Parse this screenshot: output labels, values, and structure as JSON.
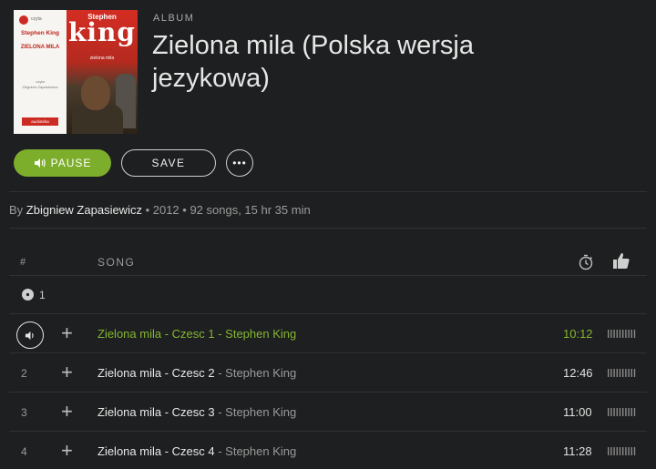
{
  "album": {
    "label": "ALBUM",
    "title": "Zielona mila (Polska wersja jezykowa)",
    "cover": {
      "author": "Stephen King",
      "big_title": "king",
      "big_author": "Stephen",
      "title": "ZIELONA MILA",
      "subtitle": "czyta",
      "reader": "Zbigniew Zapasiewicz",
      "book_title": "zielona mila",
      "badge": "audioteka",
      "publisher": "czyta"
    }
  },
  "buttons": {
    "pause": "PAUSE",
    "save": "SAVE",
    "more": "•••"
  },
  "meta": {
    "by": "By",
    "artist": "Zbigniew Zapasiewicz",
    "details": " • 2012 • 92 songs, 15 hr 35 min"
  },
  "table": {
    "col_num": "#",
    "col_song": "SONG",
    "disc_label": "1"
  },
  "tracks": [
    {
      "num": "",
      "title": "Zielona mila - Czesc 1",
      "sep": " - ",
      "artist": "Stephen King",
      "duration": "10:12",
      "active": true
    },
    {
      "num": "2",
      "title": "Zielona mila - Czesc 2",
      "sep": " - ",
      "artist": "Stephen King",
      "duration": "12:46",
      "active": false
    },
    {
      "num": "3",
      "title": "Zielona mila - Czesc 3",
      "sep": " - ",
      "artist": "Stephen King",
      "duration": "11:00",
      "active": false
    },
    {
      "num": "4",
      "title": "Zielona mila - Czesc 4",
      "sep": " - ",
      "artist": "Stephen King",
      "duration": "11:28",
      "active": false
    }
  ],
  "colors": {
    "accent": "#7dae2b",
    "accent_text": "#84b631",
    "background": "#1e1f20"
  }
}
